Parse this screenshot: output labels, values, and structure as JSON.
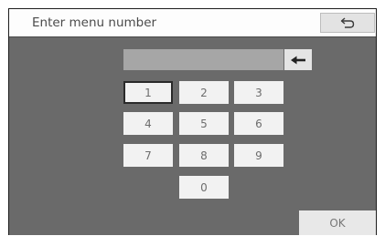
{
  "header": {
    "title": "Enter menu number",
    "back_icon": "return-arrow-icon"
  },
  "input": {
    "value": "",
    "backspace_icon": "left-arrow-icon"
  },
  "keypad": {
    "keys": [
      "1",
      "2",
      "3",
      "4",
      "5",
      "6",
      "7",
      "8",
      "9",
      "0"
    ],
    "selected_key": "1"
  },
  "footer": {
    "ok_label": "OK"
  },
  "colors": {
    "panel_bg": "#6a6a6a",
    "header_bg": "#fdfdfd",
    "key_bg": "#f2f2f2",
    "display_bg": "#a6a6a6"
  }
}
